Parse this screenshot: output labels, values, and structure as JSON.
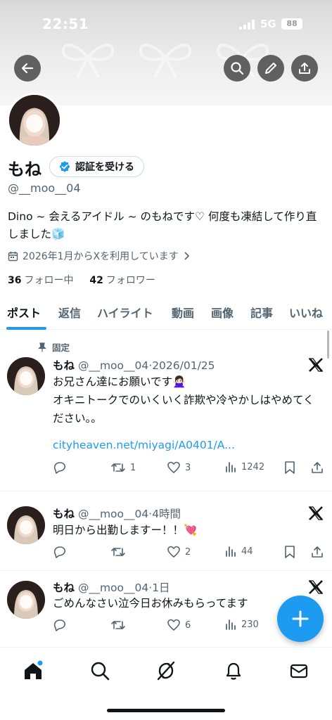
{
  "status_bar": {
    "time": "22:51",
    "network": "5G",
    "battery": "88"
  },
  "profile": {
    "name": "もね",
    "verify_label": "認証を受ける",
    "handle": "@__moo__04",
    "bio": "Dino ~ 会えるアイドル ~ のもねです♡ 何度も凍結して作り直しました🧊",
    "joined": "2026年1月からXを利用しています",
    "following_count": "36",
    "following_label": "フォロー中",
    "followers_count": "42",
    "followers_label": "フォロワー"
  },
  "tabs": [
    "ポスト",
    "返信",
    "ハイライト",
    "動画",
    "画像",
    "記事",
    "いいね"
  ],
  "pinned_label": "固定",
  "posts": [
    {
      "name": "もね",
      "handle": "@__moo__04",
      "time": "2026/01/25",
      "text": "お兄さん達にお願いです🙅🏻‍♀️\nオキニトークでのいくいく詐欺や冷やかしはやめてください。。",
      "link": "cityheaven.net/miyagi/A0401/A...",
      "replies": "",
      "reposts": "1",
      "likes": "3",
      "views": "1242"
    },
    {
      "name": "もね",
      "handle": "@__moo__04",
      "time": "4時間",
      "text": "明日から出勤しますー！！💘",
      "replies": "",
      "reposts": "",
      "likes": "2",
      "views": "44"
    },
    {
      "name": "もね",
      "handle": "@__moo__04",
      "time": "1日",
      "text": "ごめんなさい泣今日お休みもらってます",
      "replies": "",
      "reposts": "",
      "likes": "6",
      "views": "230"
    }
  ],
  "icons": {
    "back": "arrow-left-icon",
    "search": "search-icon",
    "edit": "pencil-icon",
    "share": "share-icon",
    "verified": "verified-badge-icon",
    "calendar": "calendar-icon",
    "pin": "pin-icon",
    "reply": "reply-icon",
    "repost": "repost-icon",
    "like": "heart-icon",
    "views": "views-icon",
    "bookmark": "bookmark-icon",
    "compose": "plus-icon",
    "nav": [
      "home-icon",
      "search-icon",
      "grok-icon",
      "bell-icon",
      "mail-icon"
    ]
  },
  "colors": {
    "accent": "#1d9bf0",
    "text": "#0f1419",
    "muted": "#536471"
  }
}
